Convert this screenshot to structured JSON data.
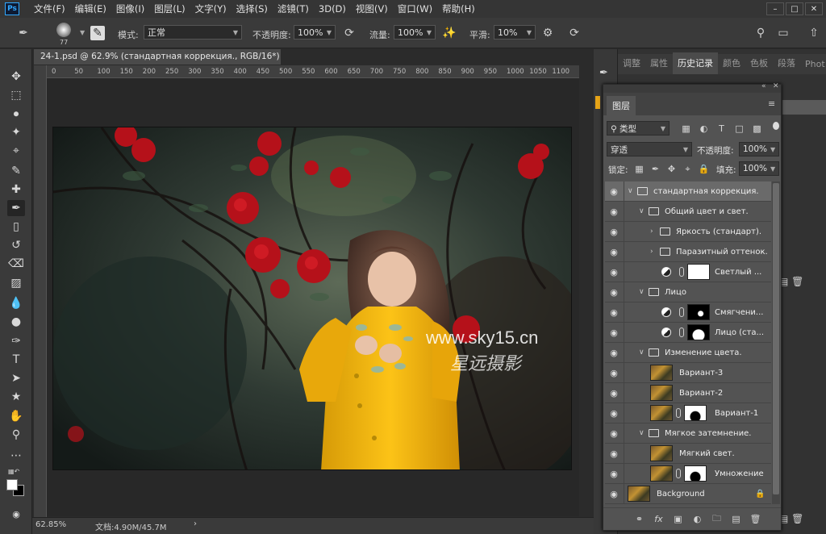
{
  "app": {
    "logo": "Ps",
    "menu": [
      "文件(F)",
      "编辑(E)",
      "图像(I)",
      "图层(L)",
      "文字(Y)",
      "选择(S)",
      "滤镜(T)",
      "3D(D)",
      "视图(V)",
      "窗口(W)",
      "帮助(H)"
    ]
  },
  "options": {
    "brush_size": "77",
    "mode_label": "模式:",
    "mode_value": "正常",
    "opacity_label": "不透明度:",
    "opacity_value": "100%",
    "flow_label": "流量:",
    "flow_value": "100%",
    "smooth_label": "平滑:",
    "smooth_value": "10%"
  },
  "document": {
    "tab_title": "24-1.psd @ 62.9% (стандартная коррекция., RGB/16*) *",
    "ruler_ticks": [
      "0",
      "50",
      "100",
      "150",
      "200",
      "250",
      "300",
      "350",
      "400",
      "450",
      "500",
      "550",
      "600",
      "650",
      "700",
      "750",
      "800",
      "850",
      "900",
      "950",
      "1000",
      "1050",
      "1100"
    ],
    "watermark_url": "www.sky15.cn",
    "watermark_cn": "星远摄影"
  },
  "status": {
    "zoom": "62.85%",
    "doc_info": "文档:4.90M/45.7M",
    "arrow": "›"
  },
  "dock": {
    "tabs": [
      "调整",
      "属性",
      "历史记录",
      "颜色",
      "色板",
      "段落",
      "Phot"
    ],
    "active_tab": "历史记录"
  },
  "layers_panel": {
    "tab": "图层",
    "filter_kind": "类型",
    "blend_mode": "穿透",
    "opacity_label": "不透明度:",
    "opacity_value": "100%",
    "lock_label": "锁定:",
    "fill_label": "填充:",
    "fill_value": "100%",
    "layers": [
      {
        "name": "стандартная коррекция.",
        "type": "group",
        "indent": 0,
        "selected": true
      },
      {
        "name": "Общий цвет и свет.",
        "type": "group",
        "indent": 1
      },
      {
        "name": "Яркость (стандарт).",
        "type": "group-collapsed",
        "indent": 2
      },
      {
        "name": "Паразитный оттенок.",
        "type": "group-collapsed",
        "indent": 2
      },
      {
        "name": "Светлый ...",
        "type": "adjustment",
        "indent": 2,
        "mask": "white"
      },
      {
        "name": "Лицо",
        "type": "group",
        "indent": 1
      },
      {
        "name": "Смягчени...",
        "type": "adjustment",
        "indent": 2,
        "mask": "black-dot"
      },
      {
        "name": "Лицо (ста...",
        "type": "adjustment",
        "indent": 2,
        "mask": "black-shape"
      },
      {
        "name": "Изменение цвета.",
        "type": "group",
        "indent": 1
      },
      {
        "name": "Вариант-3",
        "type": "pixel",
        "indent": 2
      },
      {
        "name": "Вариант-2",
        "type": "pixel",
        "indent": 2
      },
      {
        "name": "Вариант-1",
        "type": "pixel-mask",
        "indent": 2,
        "mask": "white-silhouette"
      },
      {
        "name": "Мягкое затемнение.",
        "type": "group",
        "indent": 1
      },
      {
        "name": "Мягкий свет.",
        "type": "pixel",
        "indent": 2
      },
      {
        "name": "Умножение",
        "type": "pixel-mask",
        "indent": 2,
        "mask": "white-silhouette"
      },
      {
        "name": "Background",
        "type": "background",
        "indent": 0,
        "locked": true
      }
    ]
  }
}
